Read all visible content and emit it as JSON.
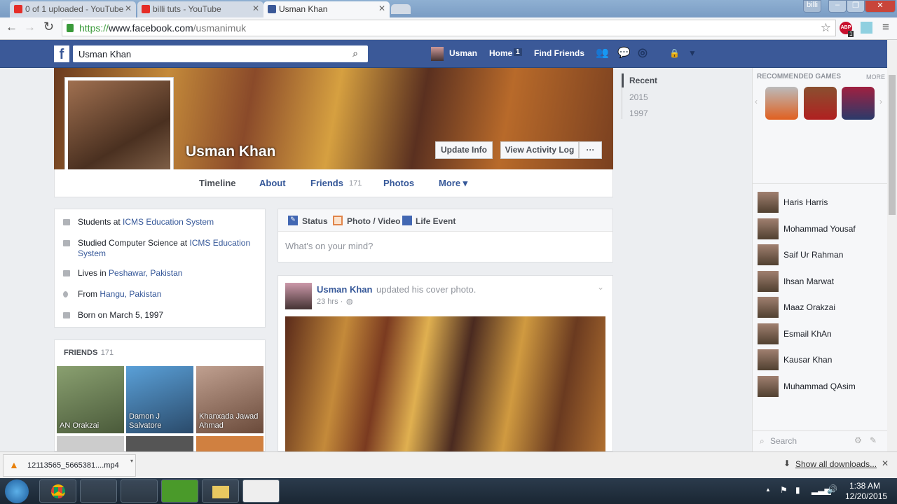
{
  "browser": {
    "tabs": [
      {
        "title": "0 of 1 uploaded - YouTube"
      },
      {
        "title": "billi tuts - YouTube"
      },
      {
        "title": "Usman Khan"
      }
    ],
    "user_badge": "billi",
    "url_scheme": "https://",
    "url_host": "www.facebook.com",
    "url_path": "/usmanimuk",
    "abp_badge": "1"
  },
  "fb": {
    "search_value": "Usman Khan",
    "nav": {
      "user": "Usman",
      "home": "Home",
      "home_count": "1",
      "find_friends": "Find Friends"
    }
  },
  "profile": {
    "name": "Usman Khan",
    "update_info": "Update Info",
    "view_activity_log": "View Activity Log",
    "more_dots": "···",
    "tabs": {
      "timeline": "Timeline",
      "about": "About",
      "friends": "Friends",
      "friends_count": "171",
      "photos": "Photos",
      "more": "More ▾"
    }
  },
  "timeline_nav": [
    "Recent",
    "2015",
    "1997"
  ],
  "intro": [
    {
      "pre": "Students at ",
      "link": "ICMS Education System",
      "post": ""
    },
    {
      "pre": "Studied Computer Science at ",
      "link": "ICMS Education System",
      "post": ""
    },
    {
      "pre": "Lives in ",
      "link": "Peshawar, Pakistan",
      "post": ""
    },
    {
      "pre": "From ",
      "link": "Hangu, Pakistan",
      "post": ""
    },
    {
      "pre": "Born on March 5, 1997",
      "link": "",
      "post": ""
    }
  ],
  "friends_box": {
    "title": "FRIENDS",
    "count": "· 171",
    "friends": [
      "AN Orakzai",
      "Damon J Salvatore",
      "Khanxada Jawad Ahmad"
    ]
  },
  "composer": {
    "status": "Status",
    "photo_video": "Photo / Video",
    "life_event": "Life Event",
    "placeholder": "What's on your mind?"
  },
  "post": {
    "author": "Usman Khan",
    "action": "updated his cover photo.",
    "time": "23 hrs ·"
  },
  "right": {
    "games_title": "RECOMMENDED GAMES",
    "games_more": "MORE",
    "chat": [
      "Haris Harris",
      "Mohammad Yousaf",
      "Saif Ur Rahman",
      "Ihsan Marwat",
      "Maaz Orakzai",
      "Esmail KhAn",
      "Kausar Khan",
      "Muhammad QAsim"
    ],
    "chat_search": "Search"
  },
  "download": {
    "file": "12113565_5665381....mp4",
    "show_all": "Show all downloads..."
  },
  "taskbar": {
    "time": "1:38 AM",
    "date": "12/20/2015"
  },
  "colors": {
    "fb_blue": "#3b5998",
    "link": "#365899"
  }
}
